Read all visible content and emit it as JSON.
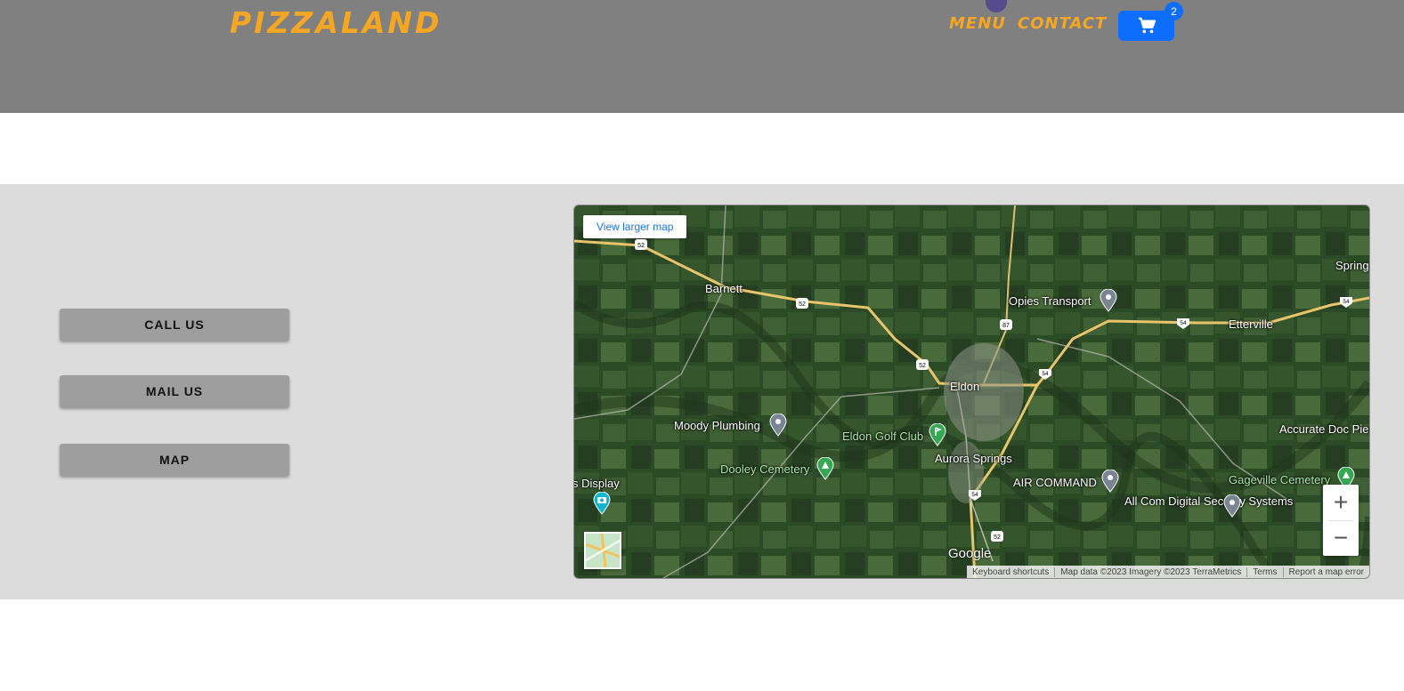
{
  "header": {
    "logo": "PIZZALAND",
    "nav": {
      "menu": "MENU",
      "contact": "CONTACT"
    },
    "cart": {
      "icon": "cart-icon",
      "count": "2"
    }
  },
  "contact_buttons": {
    "call": "CALL US",
    "mail": "MAIL US",
    "map": "MAP"
  },
  "map": {
    "larger_link": "View larger map",
    "places": {
      "barnett": "Barnett",
      "opies": "Opies Transport",
      "etterville": "Etterville",
      "spring": "Spring",
      "eldon": "Eldon",
      "moody": "Moody Plumbing",
      "golf": "Eldon Golf Club",
      "aurora": "Aurora Springs",
      "dooley": "Dooley Cemetery",
      "air": "AIR COMMAND",
      "accurate": "Accurate Doc Piers & Concret",
      "gageville": "Gageville Cemetery",
      "allcom": "All Com Digital Security Systems",
      "display": "s Display"
    },
    "routes": [
      "52",
      "52",
      "52",
      "52",
      "87",
      "54",
      "54",
      "54",
      "54",
      "52"
    ],
    "zoom_in": "+",
    "zoom_out": "−",
    "brand": "Google",
    "footer": {
      "keyboard": "Keyboard shortcuts",
      "data": "Map data ©2023 Imagery ©2023 TerraMetrics",
      "terms": "Terms",
      "report": "Report a map error"
    }
  },
  "colors": {
    "header_bg": "#808080",
    "logo": "#f5a623",
    "cart": "#0d6efd",
    "section_bg": "#dcdcdc",
    "button": "#9e9e9e"
  }
}
